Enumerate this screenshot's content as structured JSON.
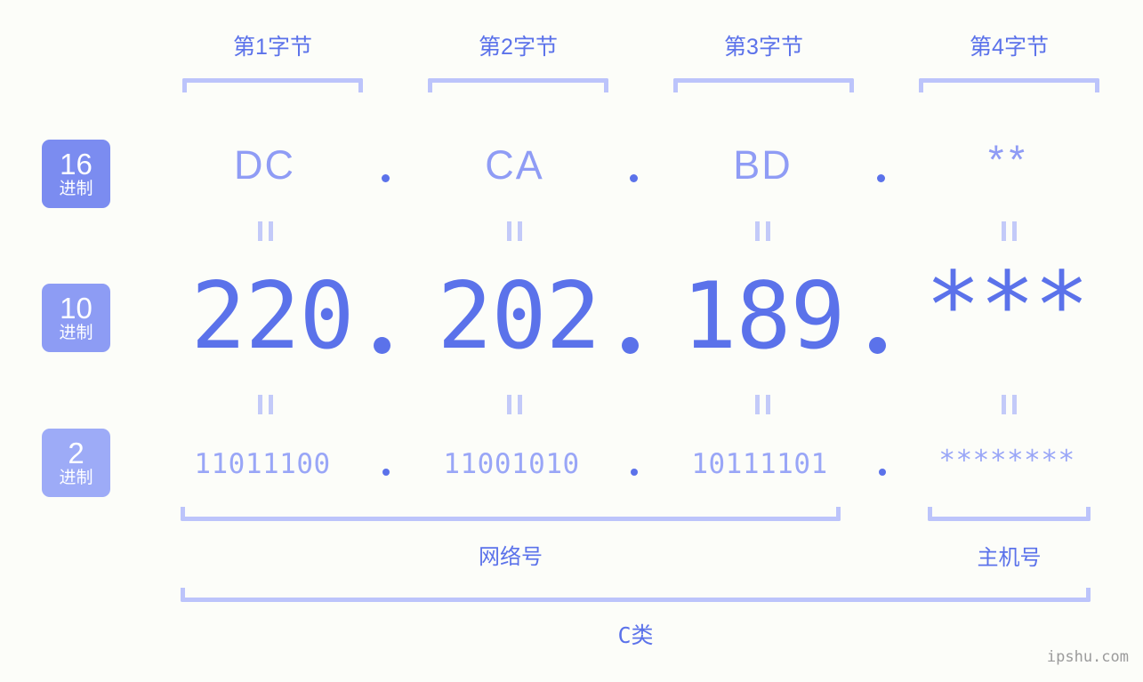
{
  "page": {
    "background_color": "#fcfdf9",
    "accent_color": "#5b72ea",
    "accent_light": "#8f9cf5",
    "accent_pale": "#bcc4fb"
  },
  "byte_headers": [
    {
      "label": "第1字节"
    },
    {
      "label": "第2字节"
    },
    {
      "label": "第3字节"
    },
    {
      "label": "第4字节"
    }
  ],
  "radix_badges": [
    {
      "number": "16",
      "suffix": "进制",
      "color": "#7b8cf0"
    },
    {
      "number": "10",
      "suffix": "进制",
      "color": "#8d9cf4"
    },
    {
      "number": "2",
      "suffix": "进制",
      "color": "#9dabf7"
    }
  ],
  "rows": {
    "hex": {
      "values": [
        "DC",
        "CA",
        "BD",
        "**"
      ]
    },
    "decimal": {
      "values": [
        "220",
        "202",
        "189",
        "***"
      ]
    },
    "binary": {
      "values": [
        "11011100",
        "11001010",
        "10111101",
        "********"
      ]
    }
  },
  "separator": ".",
  "equals_symbol": "=",
  "segments": [
    {
      "label": "网络号"
    },
    {
      "label": "主机号"
    }
  ],
  "ip_class": {
    "label": "C类"
  },
  "watermark": {
    "text": "ipshu.com"
  }
}
